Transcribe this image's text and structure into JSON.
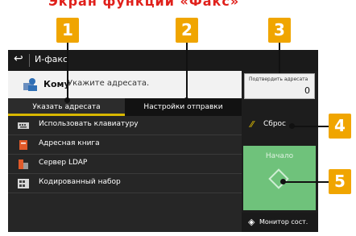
{
  "header_text": "Экран функции «Факс»",
  "callouts": [
    "1",
    "2",
    "3",
    "4",
    "5"
  ],
  "screen": {
    "back_icon": "back-arrow-icon",
    "title": "И-факс",
    "to_label": "Кому",
    "to_placeholder": "Укажите адресата.",
    "tabs": [
      {
        "label": "Указать адресата",
        "active": true
      },
      {
        "label": "Настройки отправки",
        "active": false
      }
    ],
    "menu": [
      {
        "label": "Использовать клавиатуру",
        "icon": "keyboard-icon"
      },
      {
        "label": "Адресная книга",
        "icon": "address-book-icon"
      },
      {
        "label": "Сервер LDAP",
        "icon": "ldap-server-icon"
      },
      {
        "label": "Кодированный набор",
        "icon": "coded-dial-icon"
      }
    ],
    "confirm_label": "Подтвердить адресата",
    "confirm_count": "0",
    "reset_label": "Сброс",
    "start_label": "Начало",
    "monitor_label": "Монитор сост."
  },
  "colors": {
    "accent": "#f0a500",
    "start": "#6fc27b",
    "tab_underline": "#d9b800",
    "header_red": "#e0201b"
  }
}
